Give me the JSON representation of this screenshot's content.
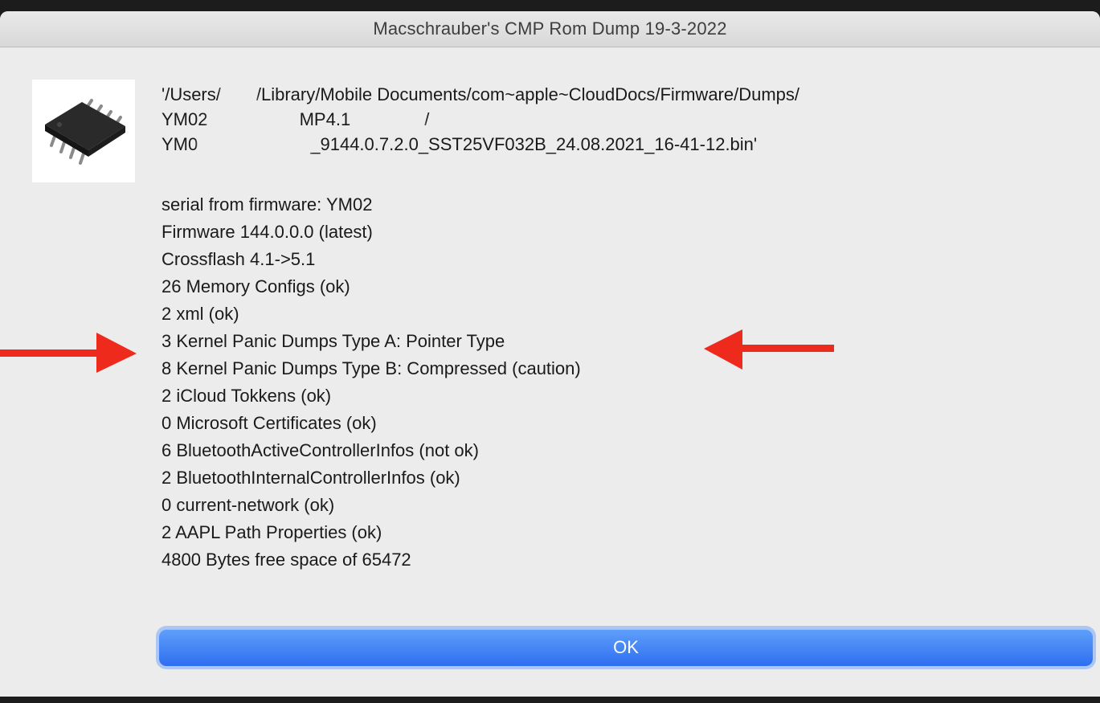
{
  "window": {
    "title": "Macschrauber's CMP Rom Dump 19-3-2022"
  },
  "icon": "eeprom-chip-icon",
  "path": {
    "line1_a": "'/Users/",
    "line1_b": "/Library/Mobile Documents/com~apple~CloudDocs/Firmware/Dumps/",
    "line2_a": "YM02",
    "line2_b": " MP4.1 ",
    "line2_c": "/",
    "line3_a": "YM0",
    "line3_b": "_9144.0.7.2.0_SST25VF032B_24.08.2021_16-41-12.bin'"
  },
  "info_lines": [
    "serial from firmware: YM02",
    "Firmware 144.0.0.0 (latest)",
    "Crossflash 4.1->5.1",
    "26 Memory Configs (ok)",
    "2 xml (ok)",
    "3 Kernel Panic Dumps Type A: Pointer Type",
    "8 Kernel Panic Dumps Type B: Compressed (caution)",
    "2 iCloud Tokkens (ok)",
    "0 Microsoft Certificates (ok)",
    "6 BluetoothActiveControllerInfos (not ok)",
    "2 BluetoothInternalControllerInfos (ok)",
    "0 current-network (ok)",
    "2 AAPL Path Properties (ok)",
    "4800 Bytes free space of 65472"
  ],
  "annotation_color": "#ee2a1c",
  "ok_label": "OK"
}
